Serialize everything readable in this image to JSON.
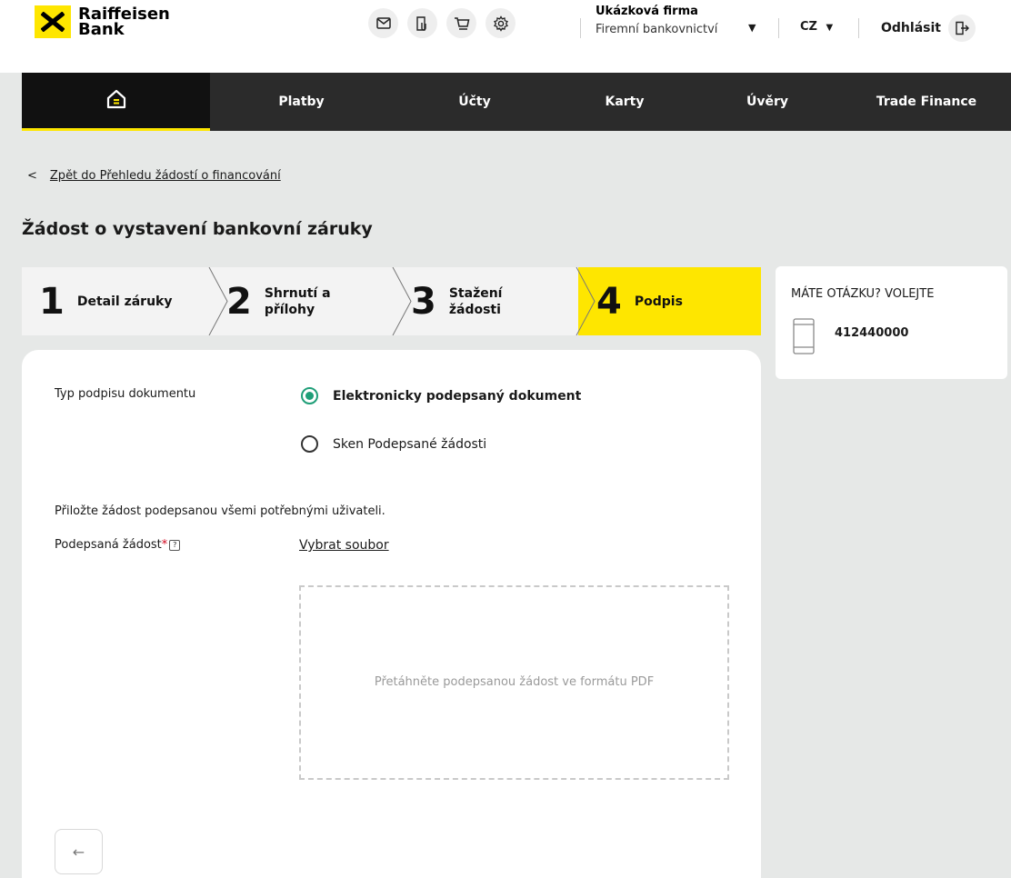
{
  "brand": {
    "line1": "Raiffeisen",
    "line2": "Bank",
    "accent": "#fee600"
  },
  "header": {
    "icons": [
      "mail-icon",
      "documents-icon",
      "cart-icon",
      "settings-icon"
    ],
    "company_name": "Ukázková firma",
    "company_sub": "Firemní bankovnictví",
    "language": "CZ",
    "logout": "Odhlásit"
  },
  "nav": {
    "items": [
      "Platby",
      "Účty",
      "Karty",
      "Úvěry",
      "Trade Finance"
    ]
  },
  "breadcrumb": {
    "back_symbol": "<",
    "label": "Zpět do Přehledu žádostí o financování"
  },
  "page_title": "Žádost o vystavení bankovní záruky",
  "steps": [
    {
      "num": "1",
      "label": "Detail záruky"
    },
    {
      "num": "2",
      "label": "Shrnutí a přílohy"
    },
    {
      "num": "3",
      "label": "Stažení žádosti"
    },
    {
      "num": "4",
      "label": "Podpis"
    }
  ],
  "form": {
    "signature_type_label": "Typ podpisu dokumentu",
    "option_electronic": "Elektronicky podepsaný dokument",
    "option_scan": "Sken Podepsané žádosti",
    "instruction": "Přiložte žádost podepsanou všemi potřebnými uživateli.",
    "signed_request_label": "Podepsaná žádost",
    "required_mark": "*",
    "help_mark": "?",
    "select_file": "Vybrat soubor",
    "dropzone_text": "Přetáhněte podepsanou žádost ve formátu PDF",
    "back_arrow": "←"
  },
  "help": {
    "title": "MÁTE OTÁZKU? VOLEJTE",
    "phone": "412440000"
  },
  "colors": {
    "nav_bg": "#2b2b2b",
    "radio_selected": "#1f9e78",
    "page_bg": "#e6e8e7"
  }
}
